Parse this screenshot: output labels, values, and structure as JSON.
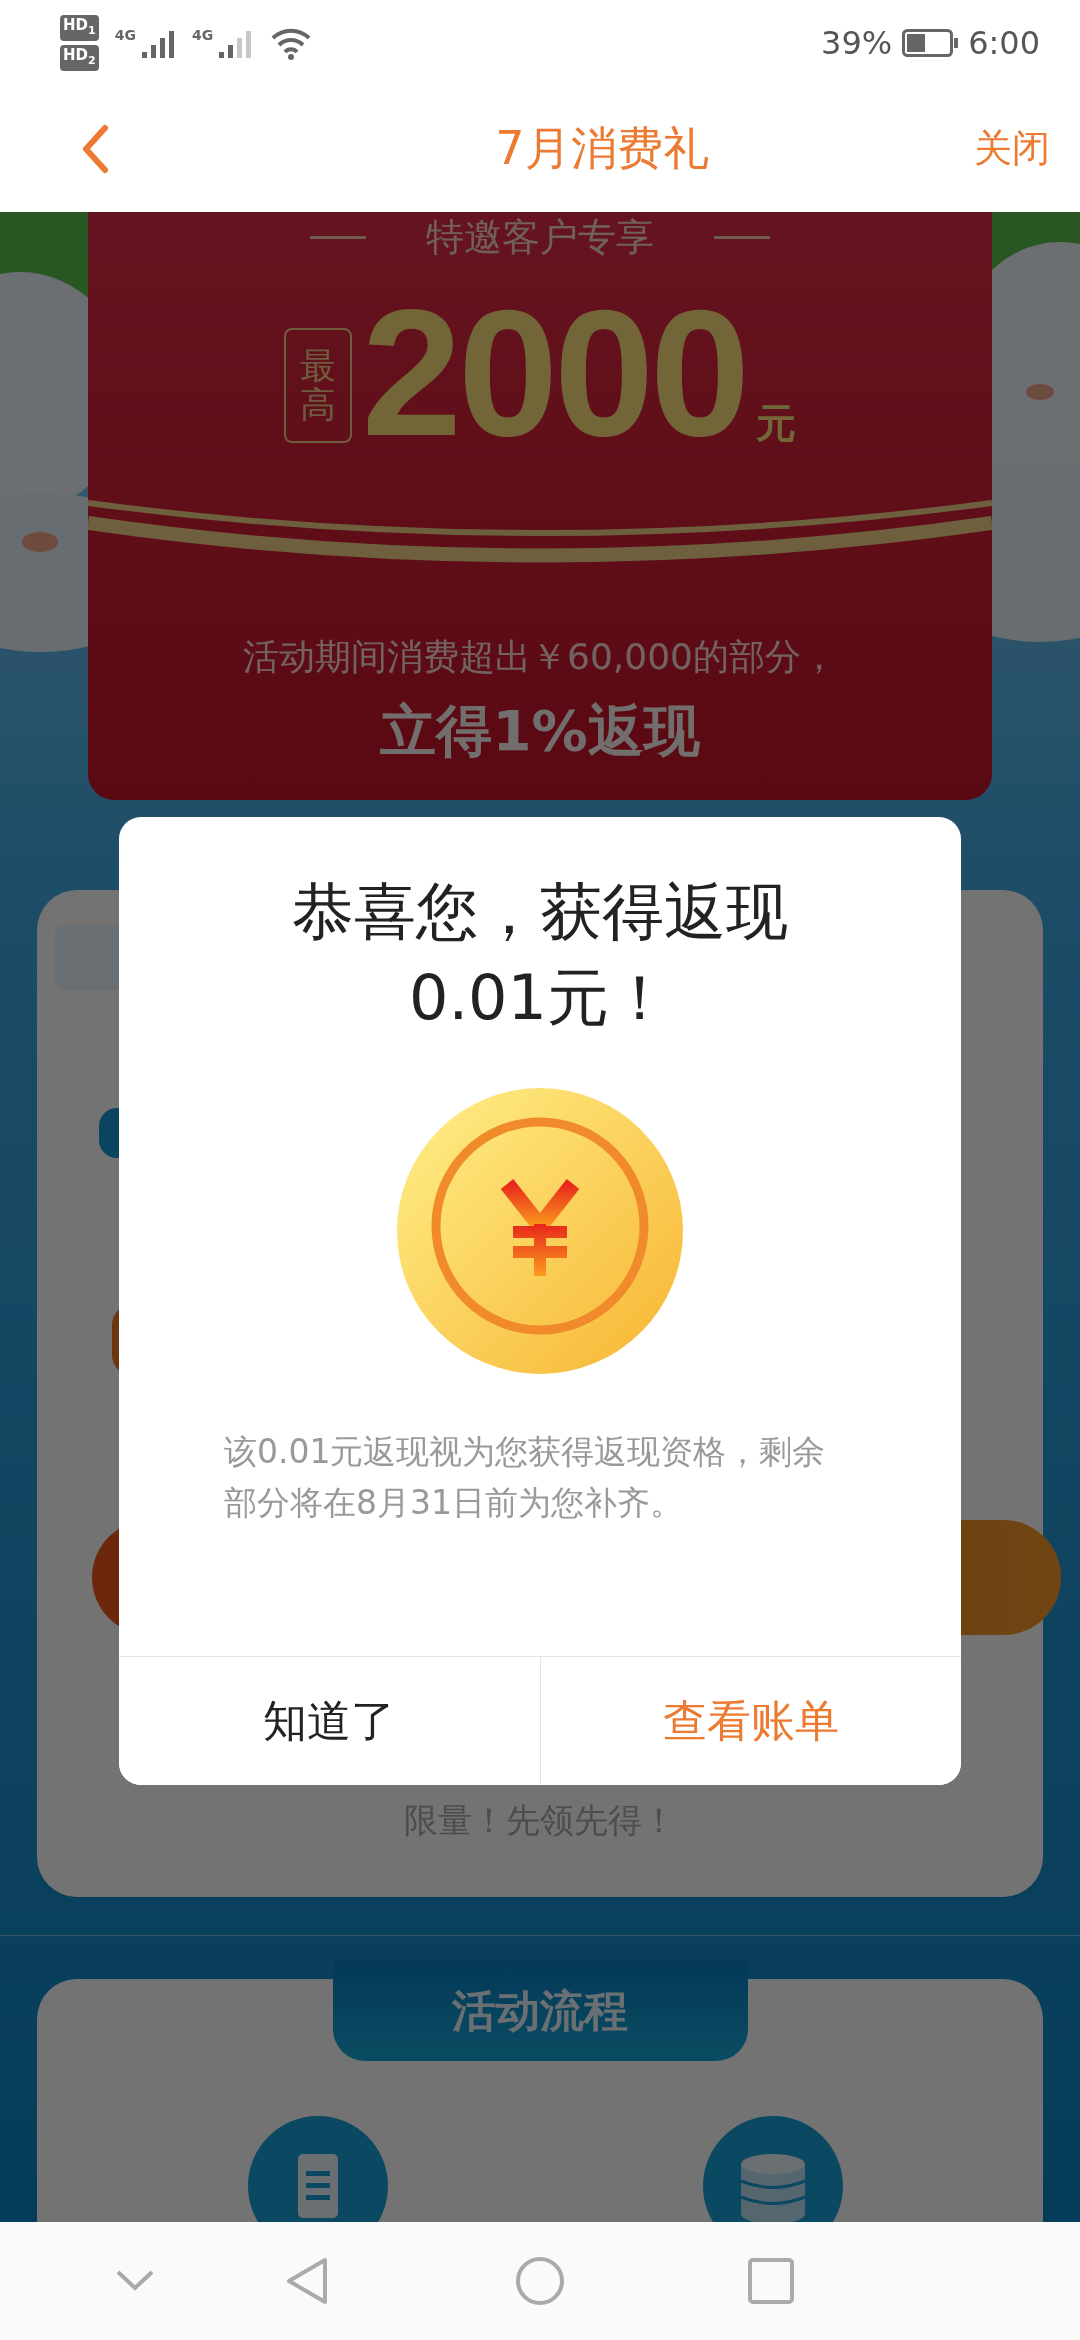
{
  "status_bar": {
    "sims": [
      {
        "label": "HD",
        "slot": "1",
        "network": "4G"
      },
      {
        "label": "HD",
        "slot": "2",
        "network": "4G"
      }
    ],
    "battery": "39%",
    "time": "6:00"
  },
  "header": {
    "title": "7月消费礼",
    "close": "关闭"
  },
  "banner": {
    "subtitle": "特邀客户专享",
    "max_label": "最高",
    "amount": "2000",
    "unit": "元",
    "condition": "活动期间消费超出￥60,000的部分，",
    "reward": "立得1%返现"
  },
  "offer_card": {
    "footnote": "限量！先领先得！"
  },
  "process_card": {
    "title": "活动流程"
  },
  "dialog": {
    "title_lines": [
      "恭喜您，获得返现",
      "0.01元！"
    ],
    "note": "该0.01元返现视为您获得返现资格，剩余部分将在8月31日前为您补齐。",
    "buttons": [
      {
        "label": "知道了",
        "kind": "dismiss"
      },
      {
        "label": "查看账单",
        "kind": "primary"
      }
    ]
  }
}
